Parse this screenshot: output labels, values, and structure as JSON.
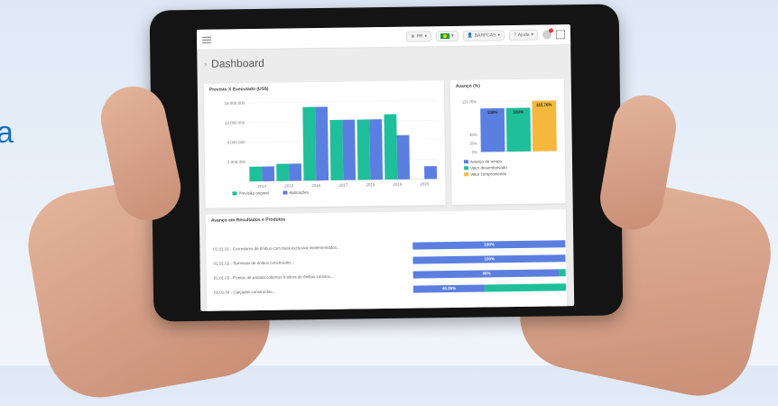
{
  "background_letter": "a",
  "topbar": {
    "menu_icon": "hamburger-icon",
    "language": "PR",
    "flag": "brazil-flag-icon",
    "user": "BARFCAS",
    "help": "Ajuda"
  },
  "page_title": "Dashboard",
  "bar_card": {
    "title": "Previsto X Executado (US$)",
    "chart_data": {
      "type": "bar",
      "title": "Previsto X Executado (US$)",
      "categories": [
        "2014",
        "2015",
        "2016",
        "2017",
        "2018",
        "2019",
        "2020"
      ],
      "y_ticks": [
        "16.000.000",
        "12.000.000",
        "8.000.000",
        "4.000.000"
      ],
      "ylim": [
        0,
        16000000
      ],
      "series": [
        {
          "name": "Previsão original",
          "color": "#1fbf9a",
          "values": [
            3000000,
            3500000,
            15000000,
            12300000,
            12300000,
            13300000,
            0
          ]
        },
        {
          "name": "Aplicações",
          "color": "#5b7fe0",
          "values": [
            3000000,
            3500000,
            15000000,
            12300000,
            12300000,
            9000000,
            2600000
          ]
        }
      ]
    }
  },
  "avanco_card": {
    "title": "Avanço (%)",
    "chart_data": {
      "type": "bar",
      "title": "Avanço (%)",
      "y_ticks": [
        "115.76%",
        "40%",
        "20%",
        "0%"
      ],
      "ylim": [
        0,
        120
      ],
      "series": [
        {
          "name": "Avanço do tempo",
          "color": "#5b7fe0",
          "values": [
            100
          ],
          "label": "100%"
        },
        {
          "name": "Valor desembolsado",
          "color": "#1fbf9a",
          "values": [
            100
          ],
          "label": "100%"
        },
        {
          "name": "Valor comprometido",
          "color": "#f5b83d",
          "values": [
            115.76
          ],
          "label": "115.76%"
        }
      ]
    }
  },
  "results_card": {
    "title": "Avanço em Resultados e Produtos",
    "rows": [
      {
        "label": "01.01.01 - Corredores de ônibus com faixa exclusiva implementados...",
        "value": 100,
        "text": "100%"
      },
      {
        "label": "01.01.02 - Terminais de ônibus construídos...",
        "value": 100,
        "text": "100%"
      },
      {
        "label": "01.01.03 - Pontos de parada cobertos à altura de ônibus construí...",
        "value": 96,
        "text": "96%"
      },
      {
        "label": "01.01.04 - Calçadas construídas...",
        "value": 46.35,
        "text": "46.35%"
      }
    ]
  }
}
